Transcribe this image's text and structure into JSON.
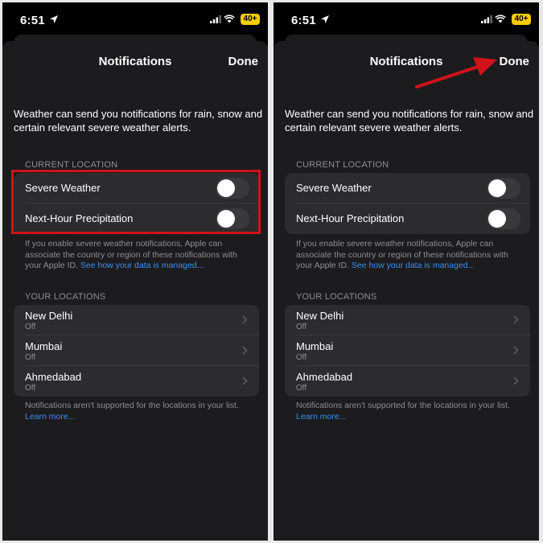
{
  "status_bar": {
    "time": "6:51",
    "battery": "40+"
  },
  "nav": {
    "title": "Notifications",
    "done_label": "Done"
  },
  "intro_text": "Weather can send you notifications for rain, snow and certain relevant severe weather alerts.",
  "current_location": {
    "header": "CURRENT LOCATION",
    "toggles": [
      {
        "label": "Severe Weather",
        "on": false
      },
      {
        "label": "Next-Hour Precipitation",
        "on": false
      }
    ],
    "footnote_text": "If you enable severe weather notifications, Apple can associate the country or region of these notifications with your Apple ID. ",
    "footnote_link": "See how your data is managed..."
  },
  "your_locations": {
    "header": "YOUR LOCATIONS",
    "items": [
      {
        "name": "New Delhi",
        "status": "Off"
      },
      {
        "name": "Mumbai",
        "status": "Off"
      },
      {
        "name": "Ahmedabad",
        "status": "Off"
      }
    ],
    "footnote_text": "Notifications aren't supported for the locations in your list. ",
    "footnote_link": "Learn more..."
  },
  "annotations": {
    "highlight_color": "#d0121b",
    "arrow_color": "#d0121b"
  }
}
